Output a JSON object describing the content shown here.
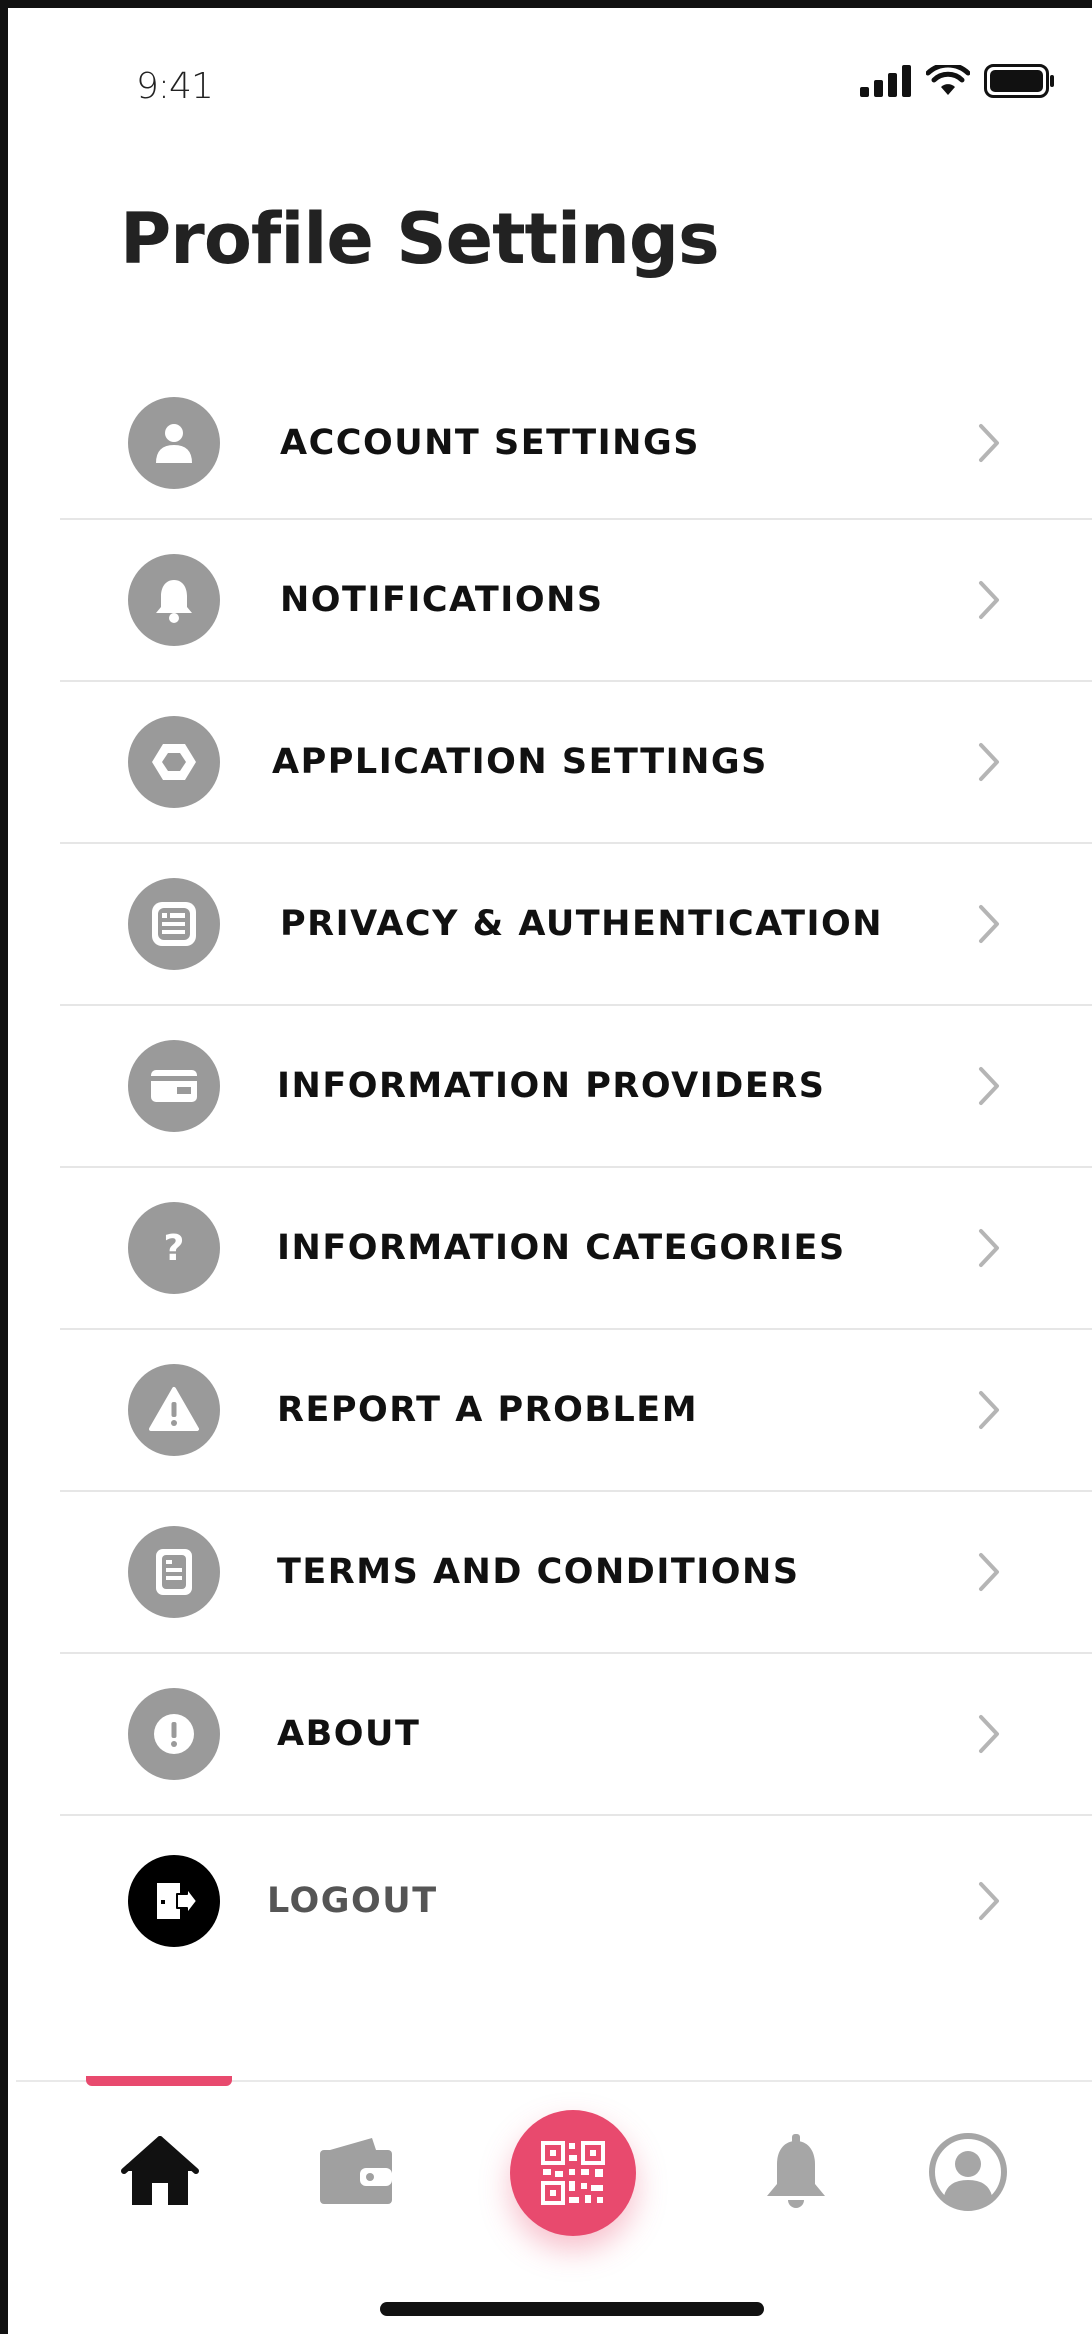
{
  "status_bar": {
    "time": "9:41"
  },
  "page": {
    "title": "Profile Settings"
  },
  "menu": {
    "items": [
      {
        "label": "ACCOUNT SETTINGS",
        "icon": "person-icon"
      },
      {
        "label": "NOTIFICATIONS",
        "icon": "bell-icon"
      },
      {
        "label": "APPLICATION SETTINGS",
        "icon": "hexagon-icon"
      },
      {
        "label": "PRIVACY & AUTHENTICATION",
        "icon": "id-card-icon"
      },
      {
        "label": "INFORMATION PROVIDERS",
        "icon": "card-icon"
      },
      {
        "label": "INFORMATION CATEGORIES",
        "icon": "question-icon"
      },
      {
        "label": "REPORT A PROBLEM",
        "icon": "warning-icon"
      },
      {
        "label": "TERMS AND CONDITIONS",
        "icon": "document-icon"
      },
      {
        "label": "ABOUT",
        "icon": "exclamation-icon"
      },
      {
        "label": "LOGOUT",
        "icon": "logout-icon"
      }
    ]
  },
  "tab_bar": {
    "tabs": [
      {
        "name": "home",
        "icon": "home-icon",
        "active": true
      },
      {
        "name": "wallet",
        "icon": "wallet-icon"
      },
      {
        "name": "scan",
        "icon": "qr-code-icon"
      },
      {
        "name": "notifications",
        "icon": "bell-icon"
      },
      {
        "name": "profile",
        "icon": "user-circle-icon"
      }
    ]
  },
  "colors": {
    "accent": "#e84a6e",
    "icon_gray": "#9a9a9a",
    "text_dark": "#111111"
  }
}
